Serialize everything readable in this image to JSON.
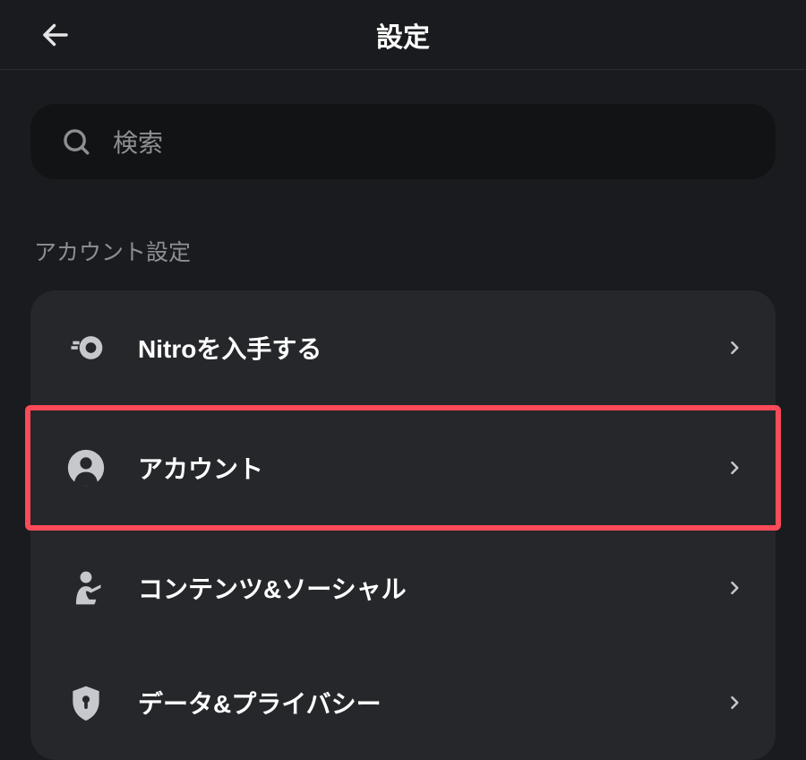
{
  "header": {
    "title": "設定"
  },
  "search": {
    "placeholder": "検索"
  },
  "section_label": "アカウント設定",
  "menu": {
    "items": [
      {
        "icon": "nitro-icon",
        "label": "Nitroを入手する",
        "highlighted": false
      },
      {
        "icon": "person-icon",
        "label": "アカウント",
        "highlighted": true
      },
      {
        "icon": "social-icon",
        "label": "コンテンツ&ソーシャル",
        "highlighted": false
      },
      {
        "icon": "shield-icon",
        "label": "データ&プライバシー",
        "highlighted": false
      }
    ]
  },
  "colors": {
    "highlight": "#fb4a59",
    "icon": "#c6c8cd"
  }
}
